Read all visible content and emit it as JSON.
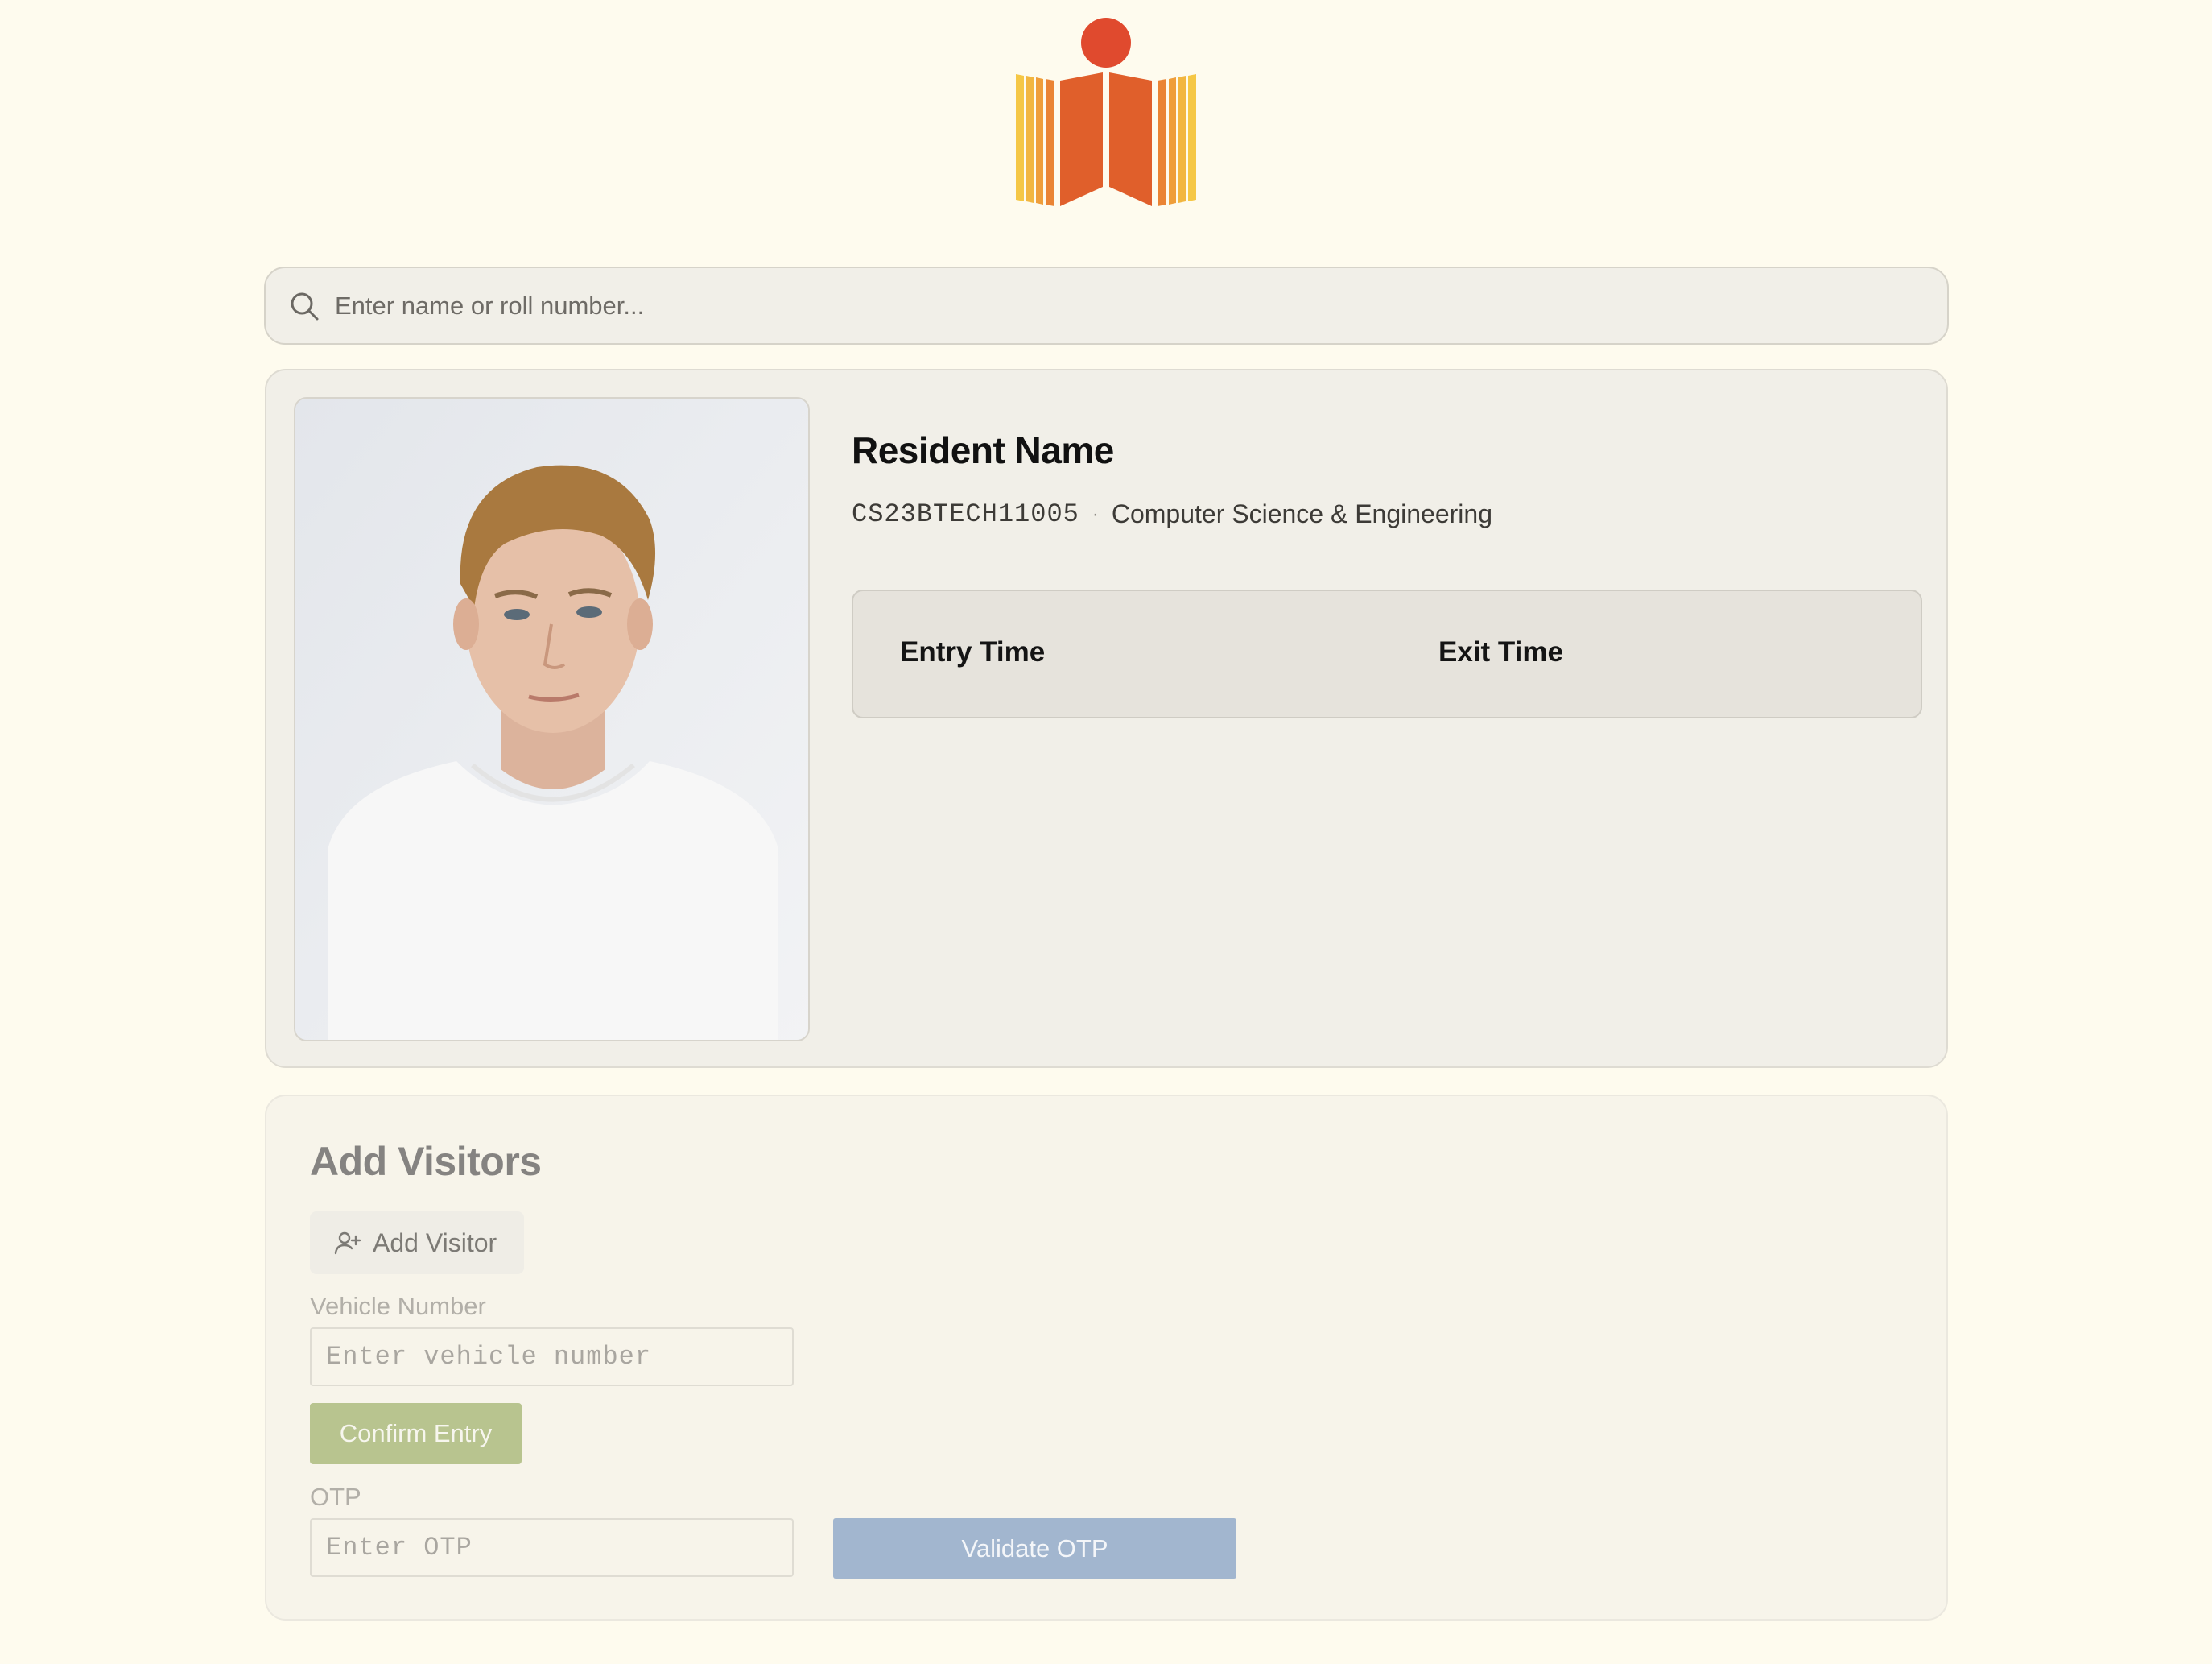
{
  "search": {
    "placeholder": "Enter name or roll number..."
  },
  "resident": {
    "name": "Resident Name",
    "roll_number": "CS23BTECH11005",
    "separator": "·",
    "department": "Computer Science & Engineering",
    "entry_time_label": "Entry Time",
    "exit_time_label": "Exit Time"
  },
  "visitors": {
    "title": "Add Visitors",
    "add_visitor_label": "Add Visitor",
    "vehicle_number_label": "Vehicle Number",
    "vehicle_number_placeholder": "Enter vehicle number",
    "confirm_entry_label": "Confirm Entry",
    "otp_label": "OTP",
    "otp_placeholder": "Enter OTP",
    "validate_otp_label": "Validate OTP"
  },
  "icons": {
    "logo": "institute-logo-icon",
    "search": "search-icon",
    "add_visitor": "user-plus-icon"
  },
  "colors": {
    "page_background": "#fefbee",
    "logo_orange": "#e05f2b",
    "logo_yellow": "#f0b843",
    "logo_red_dot": "#e04a2e",
    "confirm_button": "#b8c48f",
    "validate_button": "#a2b6cf"
  }
}
